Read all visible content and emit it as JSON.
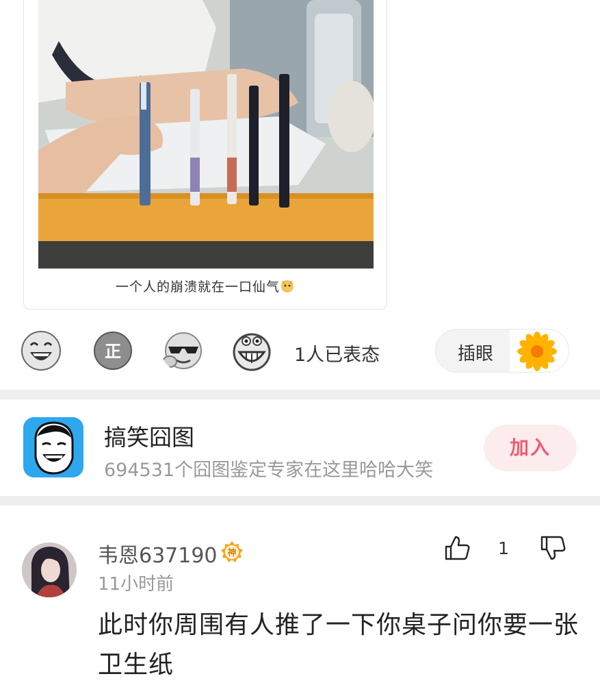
{
  "post": {
    "caption": "一个人的崩溃就在一口仙气",
    "caption_emoji": "dog-face-emoji"
  },
  "reactions": {
    "icons": [
      "laughing-face-icon",
      "zheng-badge-icon",
      "sunglasses-face-icon",
      "grinning-face-icon"
    ],
    "count_text": "1人已表态",
    "eye_button_label": "插眼",
    "eye_button_icon": "sunflower-icon"
  },
  "group": {
    "name": "搞笑囧图",
    "description": "694531个囧图鉴定专家在这里哈哈大笑",
    "join_label": "加入",
    "accent": "#ef5b74"
  },
  "comment": {
    "username": "韦恩637190",
    "badge": "神",
    "time": "11小时前",
    "like_count": "1",
    "text": "此时你周围有人推了一下你桌子问你要一张卫生纸"
  }
}
